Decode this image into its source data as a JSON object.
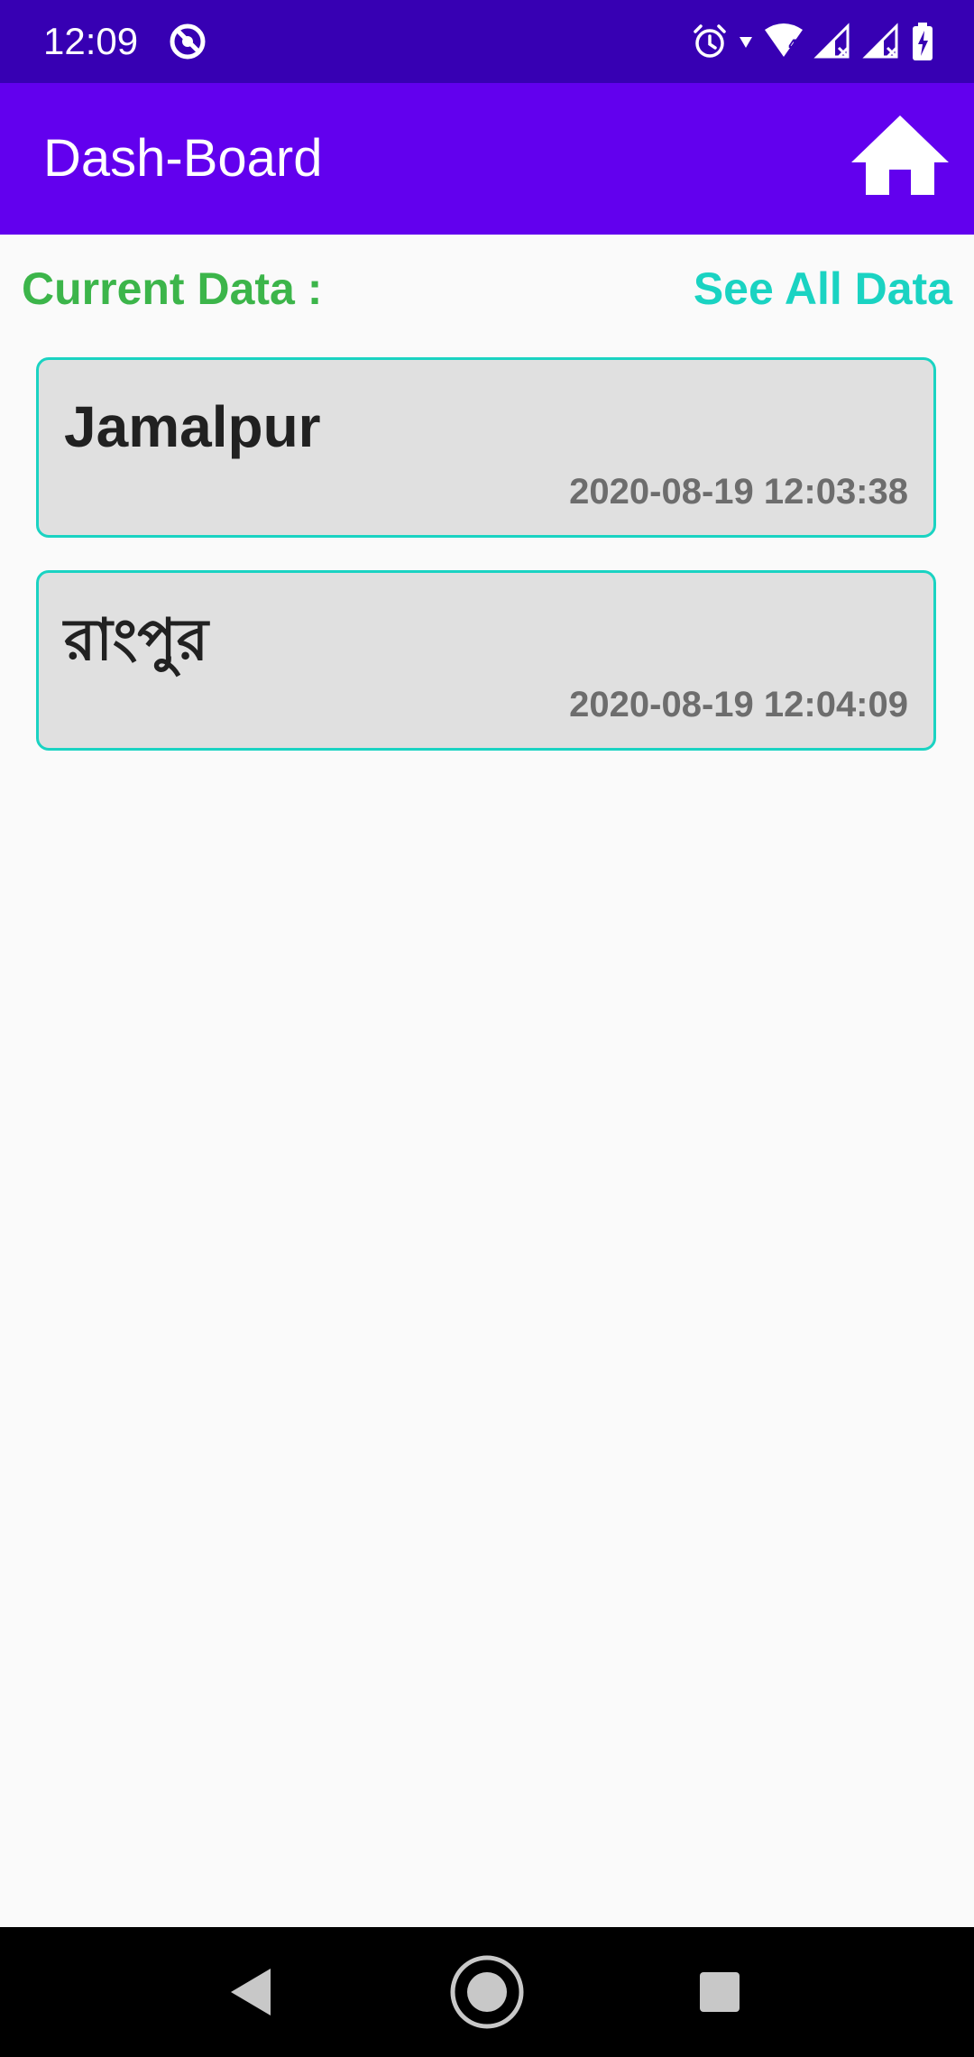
{
  "status_bar": {
    "time": "12:09",
    "background": "#3700b3",
    "icons": [
      "sync-icon",
      "alarm-icon",
      "wifi-icon",
      "signal-icon",
      "battery-icon"
    ]
  },
  "app_bar": {
    "title": "Dash-Board",
    "background": "#6200ee",
    "home_icon": "home-icon"
  },
  "section": {
    "current_label": "Current Data :",
    "see_all_label": "See All Data"
  },
  "cards": [
    {
      "title": "Jamalpur",
      "timestamp": "2020-08-19 12:03:38"
    },
    {
      "title": "রাংপুর",
      "timestamp": "2020-08-19 12:04:09"
    }
  ],
  "nav_bar": {
    "icons": [
      "back-icon",
      "home-circle-icon",
      "recents-icon"
    ]
  },
  "colors": {
    "accent_teal": "#1ad3c2",
    "label_green": "#3cb54a",
    "card_bg": "#e0e0e0"
  }
}
